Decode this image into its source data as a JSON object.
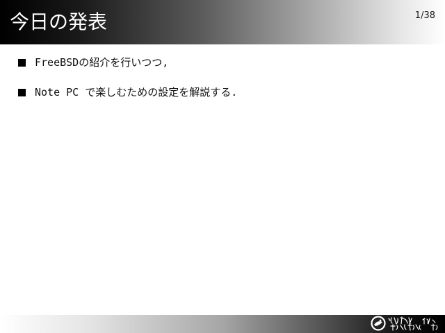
{
  "slide": {
    "title": "今日の発表",
    "page_number": "1/38"
  },
  "bullets": [
    {
      "text": "FreeBSDの紹介を行いつつ,"
    },
    {
      "text": "Note PC で楽しむための設定を解説する."
    }
  ],
  "footer": {
    "logo_icon": "calligraphy-logo-icon",
    "logo_text": "日本 酒作 愛 北 極 夫 目"
  },
  "colors": {
    "title_text": "#ffffff",
    "body_text": "#111111",
    "bullet": "#000000"
  }
}
